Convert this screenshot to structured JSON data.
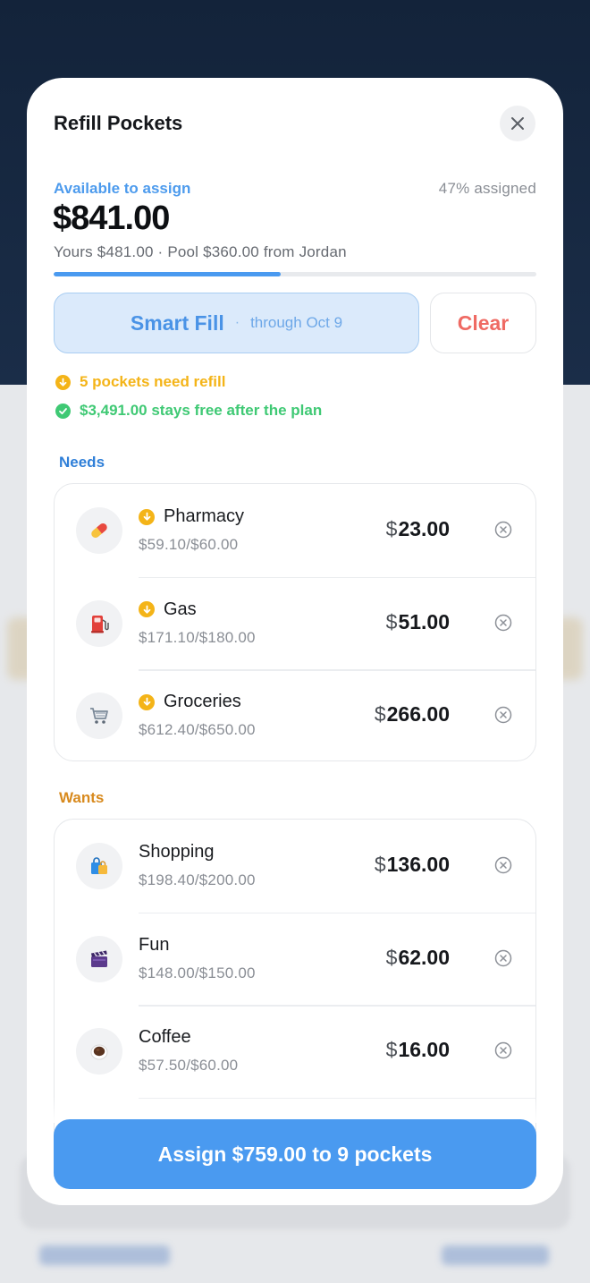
{
  "sheet": {
    "title": "Refill Pockets",
    "available_label": "Available to assign",
    "assigned_percent_text": "47% assigned",
    "assigned_fraction": 0.47,
    "available_amount": "$841.00",
    "available_breakdown": "Yours $481.00 · Pool $360.00 from Jordan",
    "smart_fill": {
      "label": "Smart Fill",
      "separator": "·",
      "sublabel": "through Oct 9"
    },
    "clear_label": "Clear",
    "notices": {
      "refill": "5 pockets need refill",
      "free": "$3,491.00 stays free after the plan"
    },
    "sections": {
      "needs": {
        "label": "Needs",
        "items": [
          {
            "name": "Pharmacy",
            "usage": "$59.10/$60.00",
            "currency": "$",
            "amount": "23.00",
            "icon": "pill-icon",
            "needs_refill": true
          },
          {
            "name": "Gas",
            "usage": "$171.10/$180.00",
            "currency": "$",
            "amount": "51.00",
            "icon": "fuel-pump-icon",
            "needs_refill": true
          },
          {
            "name": "Groceries",
            "usage": "$612.40/$650.00",
            "currency": "$",
            "amount": "266.00",
            "icon": "shopping-cart-icon",
            "needs_refill": true
          }
        ]
      },
      "wants": {
        "label": "Wants",
        "items": [
          {
            "name": "Shopping",
            "usage": "$198.40/$200.00",
            "currency": "$",
            "amount": "136.00",
            "icon": "shopping-bags-icon",
            "needs_refill": false
          },
          {
            "name": "Fun",
            "usage": "$148.00/$150.00",
            "currency": "$",
            "amount": "62.00",
            "icon": "clapperboard-icon",
            "needs_refill": false
          },
          {
            "name": "Coffee",
            "usage": "$57.50/$60.00",
            "currency": "$",
            "amount": "16.00",
            "icon": "coffee-cup-icon",
            "needs_refill": false
          }
        ]
      }
    },
    "assign_button": "Assign $759.00 to 9 pockets"
  },
  "colors": {
    "accent": "#4a9af0",
    "warning": "#f4b418",
    "success": "#3fc974",
    "danger": "#ef6a63",
    "needs": "#2f7fd8",
    "wants": "#d88a1e"
  }
}
